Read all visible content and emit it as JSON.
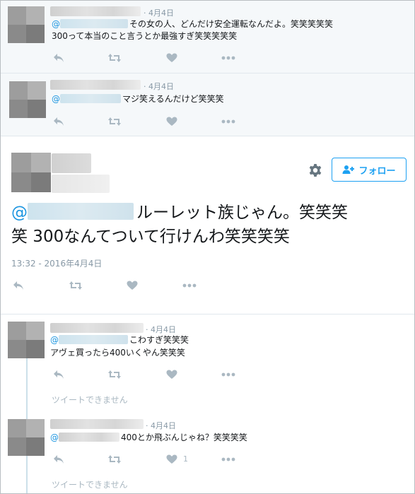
{
  "colors": {
    "accent": "#1da1f2",
    "mention": "#1b95e0",
    "muted": "#aab8c2",
    "text": "#14171a"
  },
  "icons": {
    "reply": "reply-icon",
    "retweet": "retweet-icon",
    "like": "heart-icon",
    "more": "more-dots-icon",
    "settings": "gear-icon",
    "follow": "follow-person-icon"
  },
  "tweets": [
    {
      "date": "· 4月4日",
      "mention": "@",
      "line1": "その女の人、どんだけ安全運転なんだよ。笑笑笑笑笑",
      "line2": "300って本当のこと言うとか最強すぎ笑笑笑笑笑"
    },
    {
      "date": "· 4月4日",
      "mention": "@",
      "line1": "マジ笑えるんだけど笑笑笑",
      "line2": ""
    }
  ],
  "main": {
    "follow_label": "フォロー",
    "mention": "@",
    "text_line1": "ルーレット族じゃん。笑笑笑",
    "text_line2": "笑  300なんてついて行けんわ笑笑笑笑",
    "timestamp": "13:32 - 2016年4月4日"
  },
  "replies": [
    {
      "date": "· 4月4日",
      "mention": "@",
      "line1": "こわすぎ笑笑笑",
      "line2": "アヴェ買ったら400いくやん笑笑笑",
      "unavailable": "ツイートできません",
      "like_count": ""
    },
    {
      "date": "· 4月4日",
      "mention": "@",
      "line1": "400とか飛ぶんじゃね？笑笑笑笑",
      "line2": "",
      "unavailable": "ツイートできません",
      "like_count": "1"
    }
  ]
}
